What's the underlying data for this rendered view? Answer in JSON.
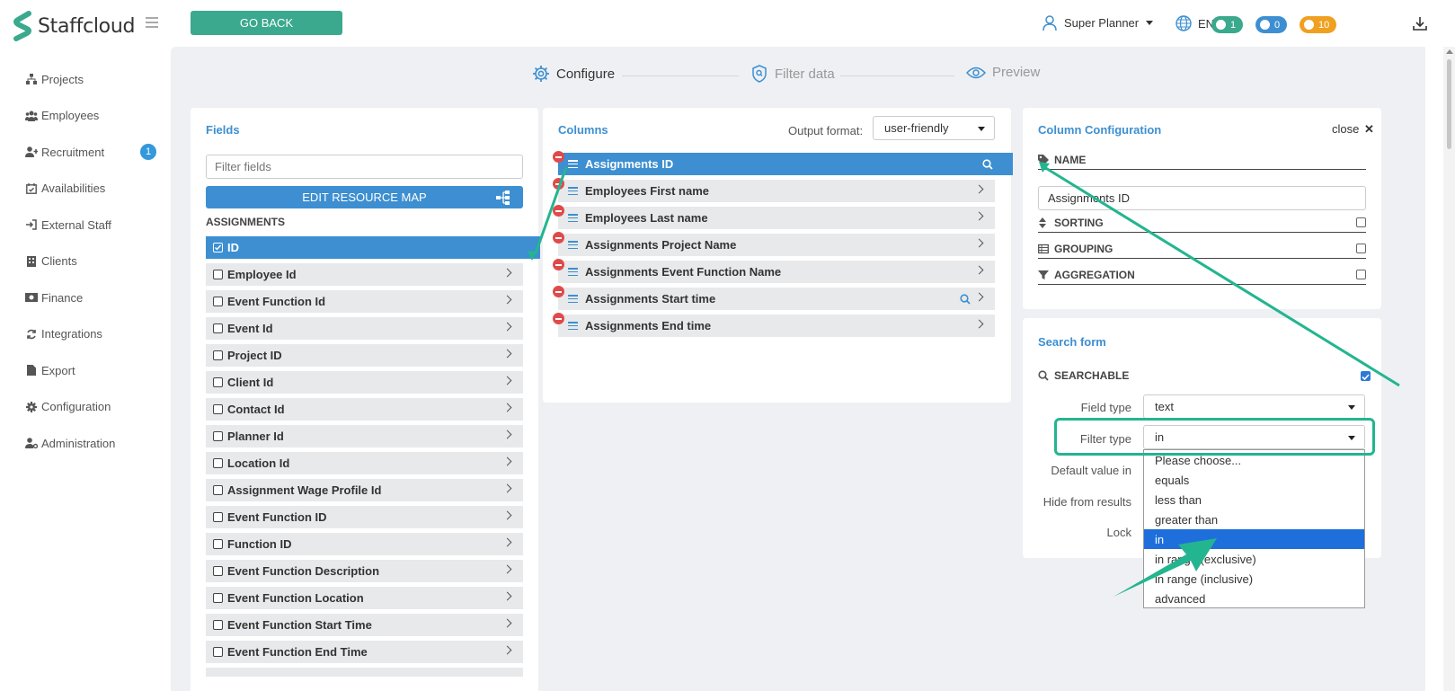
{
  "app": {
    "name": "Staffcloud"
  },
  "topbar": {
    "go_back_label": "GO BACK",
    "user_name": "Super Planner",
    "language": "EN",
    "counters": [
      {
        "icon": "chat-icon",
        "value": "1",
        "color": "#3aa98d"
      },
      {
        "icon": "bell-icon",
        "value": "0",
        "color": "#3d8fd1"
      },
      {
        "icon": "coin-icon",
        "value": "10",
        "color": "#f0a020"
      }
    ]
  },
  "nav": {
    "items": [
      {
        "label": "Projects",
        "icon": "sitemap-icon"
      },
      {
        "label": "Employees",
        "icon": "users-icon"
      },
      {
        "label": "Recruitment",
        "icon": "user-plus-icon",
        "badge": "1"
      },
      {
        "label": "Availabilities",
        "icon": "calendar-check-icon"
      },
      {
        "label": "External Staff",
        "icon": "sign-in-icon"
      },
      {
        "label": "Clients",
        "icon": "building-icon"
      },
      {
        "label": "Finance",
        "icon": "money-icon"
      },
      {
        "label": "Integrations",
        "icon": "sync-icon"
      },
      {
        "label": "Export",
        "icon": "file-icon"
      },
      {
        "label": "Configuration",
        "icon": "cog-icon"
      },
      {
        "label": "Administration",
        "icon": "user-cog-icon"
      }
    ]
  },
  "steps": [
    {
      "label": "Configure",
      "icon": "gear-icon",
      "active": true
    },
    {
      "label": "Filter data",
      "icon": "shield-search-icon",
      "active": false
    },
    {
      "label": "Preview",
      "icon": "eye-icon",
      "active": false
    }
  ],
  "fields": {
    "title": "Fields",
    "filter_placeholder": "Filter fields",
    "edit_resource_map_label": "EDIT RESOURCE MAP",
    "section": "ASSIGNMENTS",
    "items": [
      {
        "label": "ID",
        "checked": true,
        "active": true
      },
      {
        "label": "Employee Id"
      },
      {
        "label": "Event Function Id"
      },
      {
        "label": "Event Id"
      },
      {
        "label": "Project ID"
      },
      {
        "label": "Client Id"
      },
      {
        "label": "Contact Id"
      },
      {
        "label": "Planner Id"
      },
      {
        "label": "Location Id"
      },
      {
        "label": "Assignment Wage Profile Id"
      },
      {
        "label": "Event Function ID"
      },
      {
        "label": "Function ID"
      },
      {
        "label": "Event Function Description"
      },
      {
        "label": "Event Function Location"
      },
      {
        "label": "Event Function Start Time"
      },
      {
        "label": "Event Function End Time"
      }
    ]
  },
  "columns": {
    "title": "Columns",
    "output_format_label": "Output format:",
    "output_format_value": "user-friendly",
    "items": [
      {
        "label": "Assignments ID",
        "active": true,
        "searchable": true
      },
      {
        "label": "Employees First name"
      },
      {
        "label": "Employees Last name"
      },
      {
        "label": "Assignments Project Name"
      },
      {
        "label": "Assignments Event Function Name"
      },
      {
        "label": "Assignments Start time",
        "searchable": true
      },
      {
        "label": "Assignments End time"
      }
    ]
  },
  "column_config": {
    "title": "Column Configuration",
    "close_label": "close",
    "name_label": "NAME",
    "name_value": "Assignments ID",
    "sorting_label": "SORTING",
    "grouping_label": "GROUPING",
    "aggregation_label": "AGGREGATION"
  },
  "search_form": {
    "title": "Search form",
    "searchable_label": "SEARCHABLE",
    "searchable_checked": true,
    "field_type_label": "Field type",
    "field_type_value": "text",
    "filter_type_label": "Filter type",
    "filter_type_value": "in",
    "default_value_label": "Default value in",
    "hide_from_results_label": "Hide from results",
    "lock_label": "Lock",
    "filter_type_options": [
      "Please choose...",
      "equals",
      "less than",
      "greater than",
      "in",
      "in range (exclusive)",
      "in range (inclusive)",
      "advanced"
    ],
    "filter_type_selected_index": 4
  },
  "colors": {
    "accent": "#3d8fd1",
    "brand_green": "#3aa98d",
    "annotation": "#23b590",
    "remove": "#e04a4a"
  }
}
